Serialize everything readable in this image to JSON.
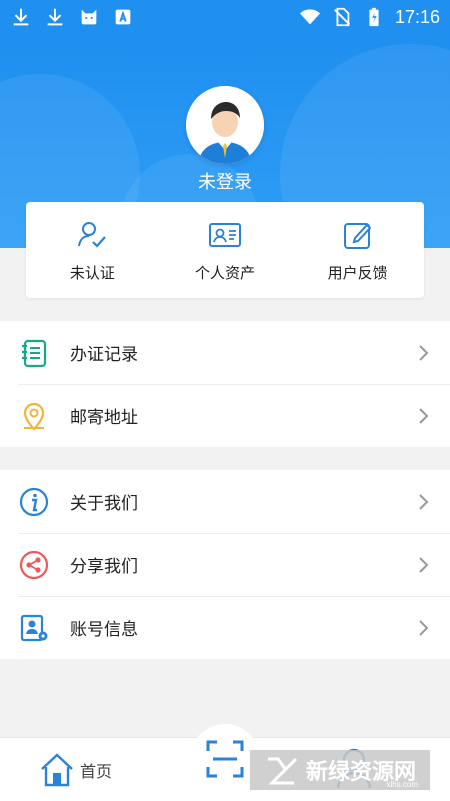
{
  "status_bar": {
    "time": "17:16",
    "left_icons": [
      "download-icon",
      "download-icon",
      "cat-icon",
      "a-icon"
    ],
    "right_icons": [
      "wifi-icon",
      "no-sim-icon",
      "battery-charging-icon"
    ]
  },
  "header": {
    "login_status": "未登录",
    "avatar_icon": "user-avatar-icon",
    "color": "#1f8ff0"
  },
  "quick_actions": [
    {
      "label": "未认证",
      "icon": "user-check-icon"
    },
    {
      "label": "个人资产",
      "icon": "id-card-icon"
    },
    {
      "label": "用户反馈",
      "icon": "edit-icon"
    }
  ],
  "list_group_1": [
    {
      "label": "办证记录",
      "icon": "notebook-icon",
      "icon_color": "#17a88a"
    },
    {
      "label": "邮寄地址",
      "icon": "location-pin-icon",
      "icon_color": "#f3b43b"
    }
  ],
  "list_group_2": [
    {
      "label": "关于我们",
      "icon": "info-icon",
      "icon_color": "#2b82d9"
    },
    {
      "label": "分享我们",
      "icon": "share-icon",
      "icon_color": "#ee5a5a"
    },
    {
      "label": "账号信息",
      "icon": "account-card-icon",
      "icon_color": "#2b82d9"
    }
  ],
  "bottom_nav": {
    "home_label": "首页",
    "home_icon": "home-icon",
    "scan_icon": "scan-icon",
    "profile_icon": "profile-icon"
  },
  "watermark": {
    "text": "新绿资源网",
    "sub": "xlhs.com"
  }
}
